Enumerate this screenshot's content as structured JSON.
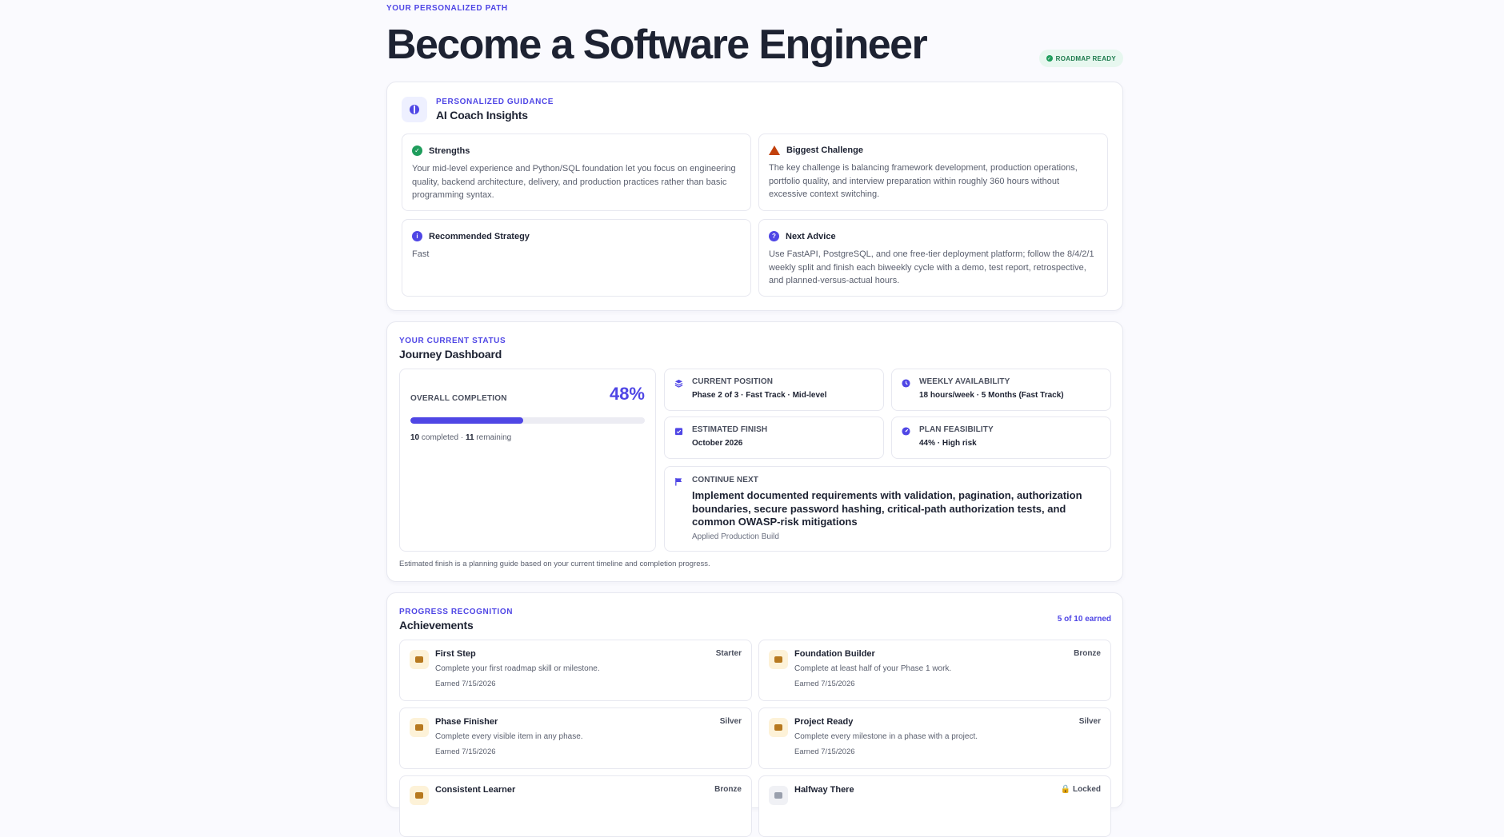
{
  "hero": {
    "eyebrow": "YOUR PERSONALIZED PATH",
    "title": "Become a Software Engineer",
    "badge": "ROADMAP READY"
  },
  "coach": {
    "eyebrow": "PERSONALIZED GUIDANCE",
    "title": "AI Coach Insights",
    "insights": [
      {
        "title": "Strengths",
        "text": "Your mid-level experience and Python/SQL foundation let you focus on engineering quality, backend architecture, delivery, and production practices rather than basic programming syntax.",
        "icon": "check-circle-icon"
      },
      {
        "title": "Biggest Challenge",
        "text": "The key challenge is balancing framework development, production operations, portfolio quality, and interview preparation within roughly 360 hours without excessive context switching.",
        "icon": "warning-icon"
      },
      {
        "title": "Recommended Strategy",
        "text": "Fast",
        "icon": "info-icon"
      },
      {
        "title": "Next Advice",
        "text": "Use FastAPI, PostgreSQL, and one free-tier deployment platform; follow the 8/4/2/1 weekly split and finish each biweekly cycle with a demo, test report, retrospective, and planned-versus-actual hours.",
        "icon": "question-icon"
      }
    ]
  },
  "journey": {
    "eyebrow": "YOUR CURRENT STATUS",
    "title": "Journey Dashboard",
    "overall_label": "OVERALL COMPLETION",
    "overall_pct": "48%",
    "progress": 0.48,
    "completed": "10",
    "completed_label": "completed",
    "remaining": "11",
    "remaining_label": "remaining",
    "stats": [
      {
        "label": "CURRENT POSITION",
        "value": "Phase 2 of 3 · Fast Track · Mid-level"
      },
      {
        "label": "WEEKLY AVAILABILITY",
        "value": "18 hours/week · 5 Months (Fast Track)"
      },
      {
        "label": "ESTIMATED FINISH",
        "value": "October 2026"
      },
      {
        "label": "PLAN FEASIBILITY",
        "value": "44% · High risk"
      }
    ],
    "next": {
      "label": "CONTINUE NEXT",
      "title": "Implement documented requirements with validation, pagination, authorization boundaries, secure password hashing, critical-path authorization tests, and common OWASP-risk mitigations",
      "sub": "Applied Production Build"
    },
    "footnote": "Estimated finish is a planning guide based on your current timeline and completion progress."
  },
  "achievements": {
    "eyebrow": "PROGRESS RECOGNITION",
    "title": "Achievements",
    "count": "5 of 10 earned",
    "items": [
      {
        "name": "First Step",
        "tier": "Starter",
        "desc": "Complete your first roadmap skill or milestone.",
        "earned": "Earned 7/15/2026"
      },
      {
        "name": "Foundation Builder",
        "tier": "Bronze",
        "desc": "Complete at least half of your Phase 1 work.",
        "earned": "Earned 7/15/2026"
      },
      {
        "name": "Phase Finisher",
        "tier": "Silver",
        "desc": "Complete every visible item in any phase.",
        "earned": "Earned 7/15/2026"
      },
      {
        "name": "Project Ready",
        "tier": "Silver",
        "desc": "Complete every milestone in a phase with a project.",
        "earned": "Earned 7/15/2026"
      },
      {
        "name": "Consistent Learner",
        "tier": "Bronze",
        "desc": "",
        "earned": ""
      },
      {
        "name": "Halfway There",
        "tier": "Locked",
        "desc": "",
        "earned": ""
      }
    ]
  },
  "colors": {
    "accent": "#4f46e5",
    "success": "#1f9d5c",
    "warning": "#c2410c",
    "badge_bg": "#fdf2d8"
  }
}
